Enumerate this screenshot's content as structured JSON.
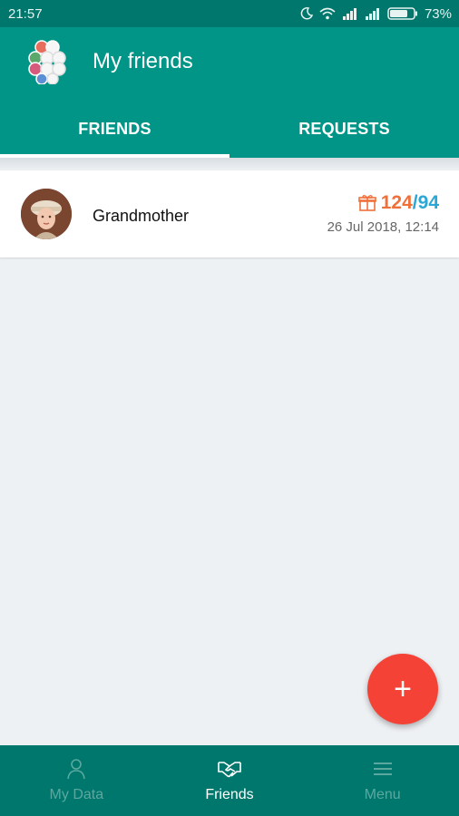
{
  "status_bar": {
    "time": "21:57",
    "battery": "73%",
    "icons": [
      "moon-icon",
      "wifi-icon",
      "signal-icon",
      "signal-icon",
      "battery-icon"
    ]
  },
  "app_bar": {
    "title": "My friends",
    "logo_icon": "hexagon-cluster-logo"
  },
  "tabs": [
    {
      "label": "FRIENDS",
      "active": true
    },
    {
      "label": "REQUESTS",
      "active": false
    }
  ],
  "friends": [
    {
      "name": "Grandmother",
      "avatar_icon": "user-photo-avatar",
      "stat_icon": "gift-icon",
      "stat_a": "124",
      "stat_sep": "/",
      "stat_b": "94",
      "timestamp": "26 Jul 2018, 12:14"
    }
  ],
  "fab": {
    "label": "+",
    "icon": "add-icon"
  },
  "bottom_nav": [
    {
      "label": "My Data",
      "icon": "person-icon",
      "active": false
    },
    {
      "label": "Friends",
      "icon": "handshake-icon",
      "active": true
    },
    {
      "label": "Menu",
      "icon": "hamburger-menu-icon",
      "active": false
    }
  ],
  "colors": {
    "primary": "#009587",
    "primary_dark": "#00776c",
    "accent": "#f44336",
    "stat_orange": "#f0703a",
    "stat_blue": "#2aa7d5"
  }
}
